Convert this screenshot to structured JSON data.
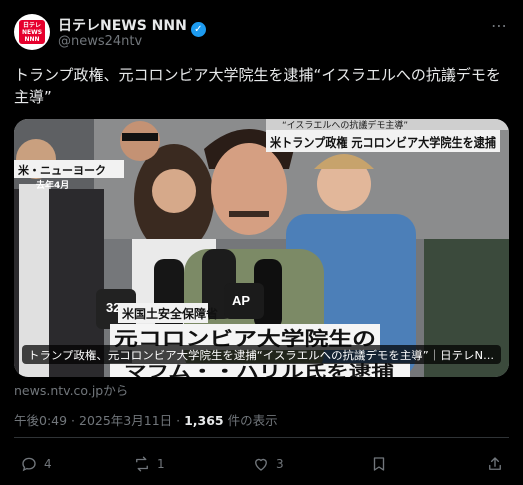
{
  "account": {
    "name": "日テレNEWS NNN",
    "handle": "@news24ntv",
    "logo_text": "日テレ NEWS NNN"
  },
  "post": {
    "text": "トランプ政権、元コロンビア大学院生を逮捕“イスラエルへの抗議デモを主導”",
    "link_source": "news.ntv.co.jpから",
    "timestamp": "午後0:49 · 2025年3月11日 · ",
    "views_count": "1,365",
    "views_label": " 件の表示"
  },
  "media": {
    "top_caption_1": "“イスラエルへの抗議デモ主導”",
    "top_caption_2": "米トランプ政権 元コロンビア大学院生を逮捕",
    "location_label": "米・ニューヨーク",
    "date_label": "去年4月",
    "mic_label_1": "32",
    "mic_label_2": "AP",
    "agency_label": "米国土安全保障省",
    "bottom_caption": "元コロンビア大学院生の",
    "bottom_caption_partial": "マフム・・ハリル氏を逮捕",
    "card_title": "トランプ政権、元コロンビア大学院生を逮捕“イスラエルへの抗議デモを主導”｜日テレN..."
  },
  "actions": {
    "replies": "4",
    "reposts": "1",
    "likes": "3"
  },
  "colors": {
    "accent": "#1d9bf0",
    "background": "#000000",
    "muted": "#71767b",
    "ntv_red": "#e6002d"
  }
}
